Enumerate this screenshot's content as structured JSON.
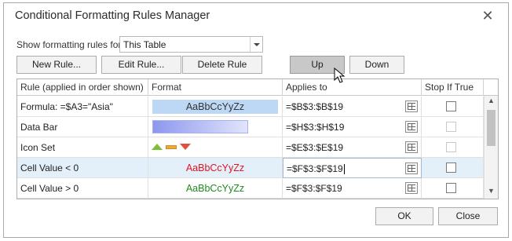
{
  "window": {
    "title": "Conditional Formatting Rules Manager",
    "close_glyph": "✕"
  },
  "filter": {
    "label": "Show formatting rules for:",
    "value": "This Table"
  },
  "toolbar": {
    "new_rule": "New Rule...",
    "edit_rule": "Edit Rule...",
    "delete_rule": "Delete Rule",
    "up": "Up",
    "down": "Down"
  },
  "grid": {
    "headers": [
      "Rule (applied in order shown)",
      "Format",
      "Applies to",
      "Stop If True"
    ],
    "rows": [
      {
        "rule": "Formula: =$A3=\"Asia\"",
        "format_kind": "text",
        "format_sample": "AaBbCcYyZz",
        "format_color": "#333333",
        "format_bg": "#bcd8f5",
        "applies_to": "=$B$3:$B$19",
        "stop_if_true": false,
        "stop_enabled": true
      },
      {
        "rule": "Data Bar",
        "format_kind": "databar",
        "applies_to": "=$H$3:$H$19",
        "stop_if_true": false,
        "stop_enabled": false
      },
      {
        "rule": "Icon Set",
        "format_kind": "iconset",
        "applies_to": "=$E$3:$E$19",
        "stop_if_true": false,
        "stop_enabled": false
      },
      {
        "rule": "Cell Value < 0",
        "format_kind": "text",
        "format_sample": "AaBbCcYyZz",
        "format_color": "#e0141e",
        "format_bg": "transparent",
        "applies_to": "=$F$3:$F$19",
        "stop_if_true": false,
        "stop_enabled": true
      },
      {
        "rule": "Cell Value > 0",
        "format_kind": "text",
        "format_sample": "AaBbCcYyZz",
        "format_color": "#1f8a1f",
        "format_bg": "transparent",
        "applies_to": "=$F$3:$F$19",
        "stop_if_true": false,
        "stop_enabled": true
      }
    ]
  },
  "footer": {
    "ok": "OK",
    "close": "Close"
  },
  "icons": {
    "close": "close-icon",
    "dropdown": "chevron-down-icon",
    "range_picker": "range-picker-icon",
    "scroll_up": "scroll-up-icon",
    "scroll_down": "scroll-down-icon",
    "pointer": "mouse-pointer-icon"
  }
}
